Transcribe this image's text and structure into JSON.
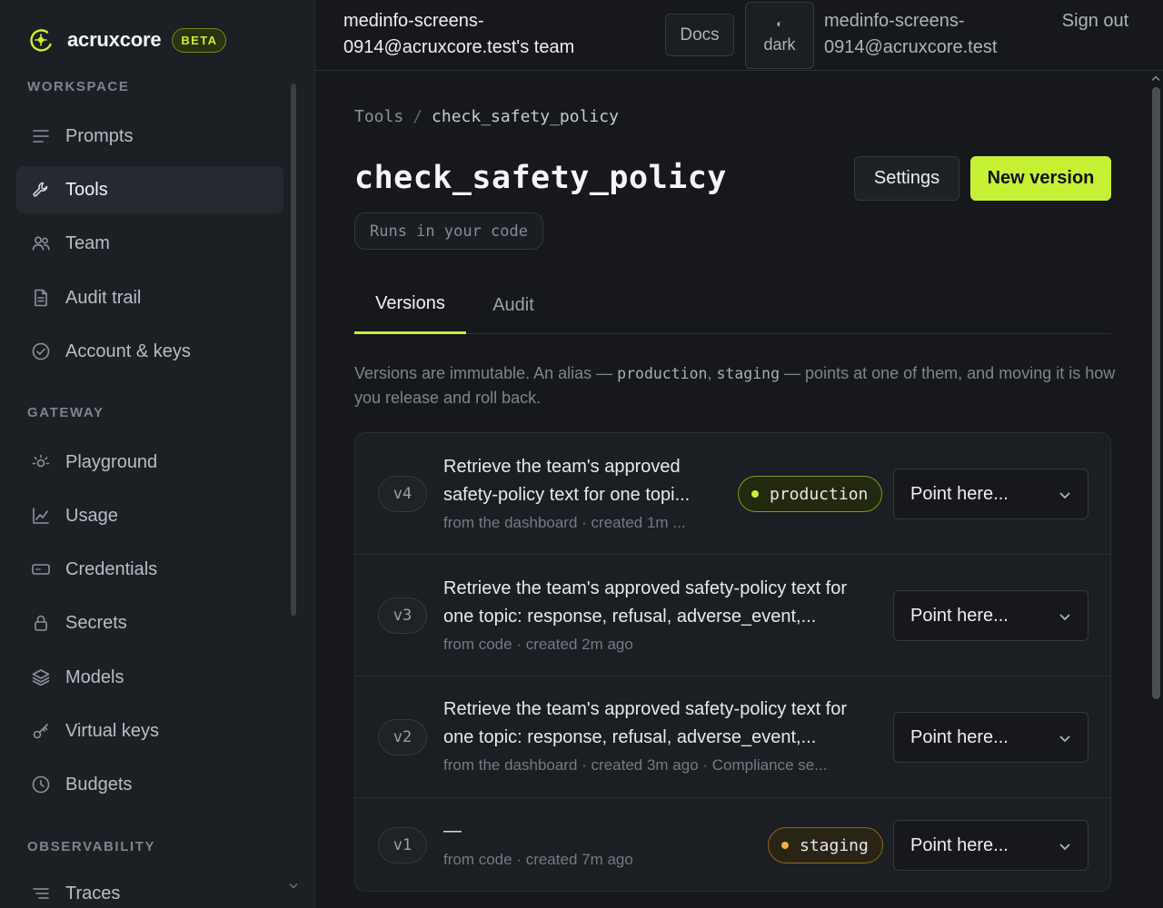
{
  "brand": {
    "name": "acruxcore",
    "badge": "BETA",
    "accent": "#c6f135"
  },
  "sidebar": {
    "sections": [
      {
        "label": "WORKSPACE"
      },
      {
        "label": "GATEWAY"
      },
      {
        "label": "OBSERVABILITY"
      }
    ],
    "items": [
      {
        "label": "Prompts",
        "icon": "list-icon"
      },
      {
        "label": "Tools",
        "icon": "wrench-icon",
        "active": true
      },
      {
        "label": "Team",
        "icon": "users-icon"
      },
      {
        "label": "Audit trail",
        "icon": "document-icon"
      },
      {
        "label": "Account & keys",
        "icon": "check-circle-icon"
      },
      {
        "label": "Playground",
        "icon": "sun-icon"
      },
      {
        "label": "Usage",
        "icon": "line-chart-icon"
      },
      {
        "label": "Credentials",
        "icon": "card-icon"
      },
      {
        "label": "Secrets",
        "icon": "lock-icon"
      },
      {
        "label": "Models",
        "icon": "layers-icon"
      },
      {
        "label": "Virtual keys",
        "icon": "key-icon"
      },
      {
        "label": "Budgets",
        "icon": "clock-icon"
      },
      {
        "label": "Traces",
        "icon": "trace-icon"
      }
    ]
  },
  "header": {
    "team": "medinfo-screens-0914@acruxcore.test's team",
    "docs": "Docs",
    "theme_glyph": "◐",
    "theme": "dark",
    "user": "medinfo-screens-0914@acruxcore.test",
    "sign_out": "Sign out"
  },
  "breadcrumb": {
    "parent": "Tools",
    "separator": "/",
    "current": "check_safety_policy"
  },
  "page": {
    "title": "check_safety_policy",
    "runs_badge": "Runs in your code",
    "settings": "Settings",
    "new_version": "New version"
  },
  "tabs": [
    {
      "label": "Versions",
      "active": true
    },
    {
      "label": "Audit"
    }
  ],
  "intro": {
    "part1": "Versions are immutable. An alias — ",
    "alias1": "production",
    "part2": ", ",
    "alias2": "staging",
    "part3": " — points at one of them, and moving it is how you release and roll back."
  },
  "versions": [
    {
      "tag": "v4",
      "description": "Retrieve the team's approved safety-policy text for one topi...",
      "meta": "from the dashboard · created 1m ...",
      "alias": "production",
      "select": "Point here..."
    },
    {
      "tag": "v3",
      "description": "Retrieve the team's approved safety-policy text for one topic: response, refusal, adverse_event,...",
      "meta": "from code · created 2m ago",
      "alias": null,
      "select": "Point here..."
    },
    {
      "tag": "v2",
      "description": "Retrieve the team's approved safety-policy text for one topic: response, refusal, adverse_event,...",
      "meta": "from the dashboard · created 3m ago · Compliance se...",
      "alias": null,
      "select": "Point here..."
    },
    {
      "tag": "v1",
      "description": "—",
      "meta": "from code · created 7m ago",
      "alias": "staging",
      "select": "Point here..."
    }
  ]
}
